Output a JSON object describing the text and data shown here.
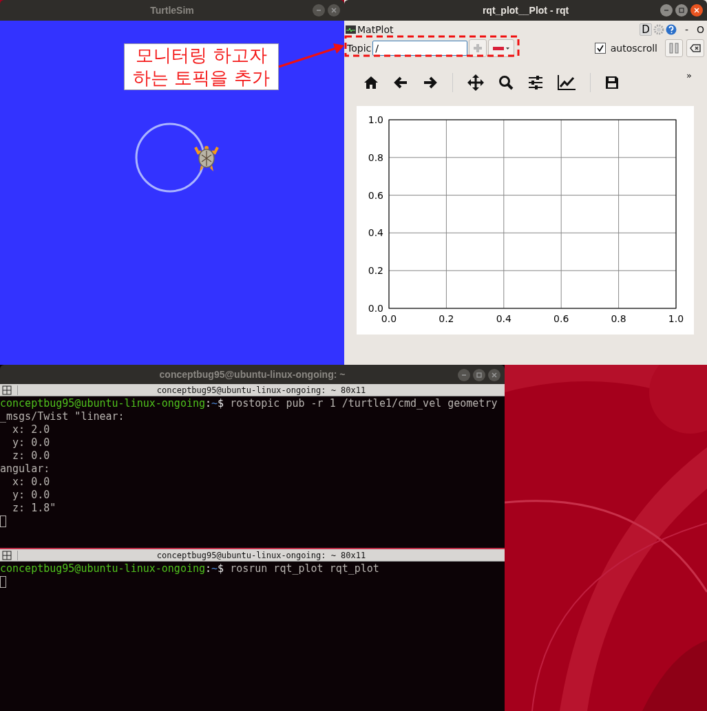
{
  "turtlesim": {
    "title": "TurtleSim",
    "annotation": [
      "모니터링 하고자",
      "하는 토픽을 추가"
    ]
  },
  "rqt": {
    "title": "rqt_plot__Plot - rqt",
    "plugin": "MatPlot",
    "dock_button": "D",
    "header_buttons": [
      "-",
      "O"
    ],
    "topic": {
      "label": "Topic",
      "value": "/"
    },
    "autoscroll": {
      "label": "autoscroll",
      "checked": true
    },
    "toolbar_more": "»",
    "chart_data": {
      "type": "line",
      "grid": true,
      "xlim": [
        0,
        1
      ],
      "ylim": [
        0,
        1
      ],
      "xticks": [
        {
          "value": 0,
          "label": "0.0"
        },
        {
          "value": 0.2,
          "label": "0.2"
        },
        {
          "value": 0.4,
          "label": "0.4"
        },
        {
          "value": 0.6,
          "label": "0.6"
        },
        {
          "value": 0.8,
          "label": "0.8"
        },
        {
          "value": 1,
          "label": "1.0"
        }
      ],
      "yticks": [
        {
          "value": 0,
          "label": "0.0"
        },
        {
          "value": 0.2,
          "label": "0.2"
        },
        {
          "value": 0.4,
          "label": "0.4"
        },
        {
          "value": 0.6,
          "label": "0.6"
        },
        {
          "value": 0.8,
          "label": "0.8"
        },
        {
          "value": 1,
          "label": "1.0"
        }
      ]
    }
  },
  "terminal": {
    "title": "conceptbug95@ubuntu-linux-ongoing: ~",
    "panes": [
      {
        "tab_title": "conceptbug95@ubuntu-linux-ongoing: ~ 80x11",
        "prompt_user": "conceptbug95@ubuntu-linux-ongoing",
        "prompt_sep": ":",
        "prompt_dir": "~",
        "prompt_sign": "$",
        "command": "rostopic pub -r 1 /turtle1/cmd_vel geometry",
        "output": [
          "_msgs/Twist \"linear:",
          "  x: 2.0",
          "  y: 0.0",
          "  z: 0.0",
          "angular:",
          "  x: 0.0",
          "  y: 0.0",
          "  z: 1.8\""
        ]
      },
      {
        "tab_title": "conceptbug95@ubuntu-linux-ongoing: ~ 80x11",
        "prompt_user": "conceptbug95@ubuntu-linux-ongoing",
        "prompt_sep": ":",
        "prompt_dir": "~",
        "prompt_sign": "$",
        "command": "rosrun rqt_plot rqt_plot"
      }
    ]
  }
}
